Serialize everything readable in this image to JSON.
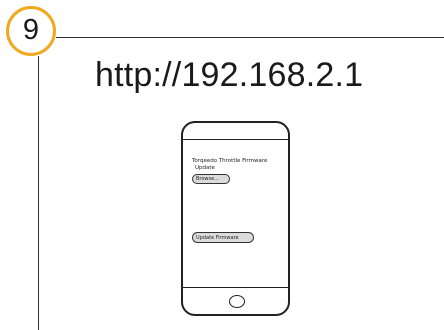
{
  "step": {
    "number": "9",
    "accent_color": "#f0a81c"
  },
  "url": "http://192.168.2.1",
  "phone_screen": {
    "title_line1": "Torqeedo Throttle Firmware",
    "title_line2": "Update",
    "browse_label": "Browse...",
    "update_label": "Update Firmware"
  }
}
